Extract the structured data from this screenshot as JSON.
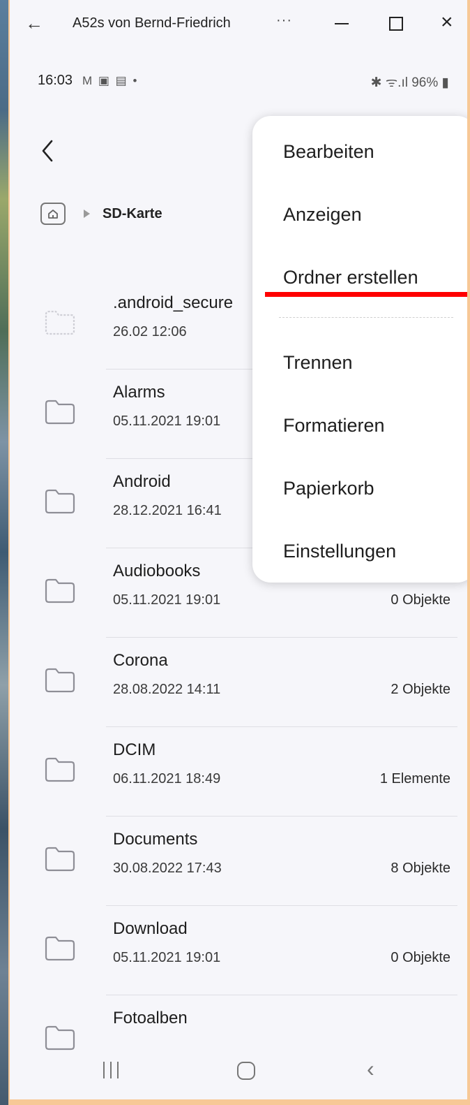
{
  "window": {
    "title": "A52s von Bernd-Friedrich",
    "more": "···"
  },
  "status_bar": {
    "time": "16:03",
    "notifications": "M ▣ ▤ •",
    "right": "✱ ᯤ.ıl 96% ▮"
  },
  "breadcrumb": {
    "current": "SD-Karte"
  },
  "files": [
    {
      "name": ".android_secure",
      "date": "26.02 12:06",
      "count": "",
      "icon": "folder-dashed-icon"
    },
    {
      "name": "Alarms",
      "date": "05.11.2021 19:01",
      "count": "",
      "icon": "folder-icon"
    },
    {
      "name": "Android",
      "date": "28.12.2021 16:41",
      "count": "",
      "icon": "folder-icon"
    },
    {
      "name": "Audiobooks",
      "date": "05.11.2021 19:01",
      "count": "0 Objekte",
      "icon": "folder-icon"
    },
    {
      "name": "Corona",
      "date": "28.08.2022 14:11",
      "count": "2 Objekte",
      "icon": "folder-icon"
    },
    {
      "name": "DCIM",
      "date": "06.11.2021 18:49",
      "count": "1 Elemente",
      "icon": "folder-icon"
    },
    {
      "name": "Documents",
      "date": "30.08.2022 17:43",
      "count": "8 Objekte",
      "icon": "folder-icon"
    },
    {
      "name": "Download",
      "date": "05.11.2021 19:01",
      "count": "0 Objekte",
      "icon": "folder-icon"
    },
    {
      "name": "Fotoalben",
      "date": "",
      "count": "",
      "icon": "folder-icon"
    }
  ],
  "menu": {
    "items": [
      {
        "label": "Bearbeiten"
      },
      {
        "label": "Anzeigen"
      },
      {
        "label": "Ordner erstellen"
      },
      {
        "label": "Trennen"
      },
      {
        "label": "Formatieren"
      },
      {
        "label": "Papierkorb"
      },
      {
        "label": "Einstellungen"
      }
    ]
  },
  "colors": {
    "highlight_underline": "#ff0000",
    "page_border": "#f7c896"
  }
}
